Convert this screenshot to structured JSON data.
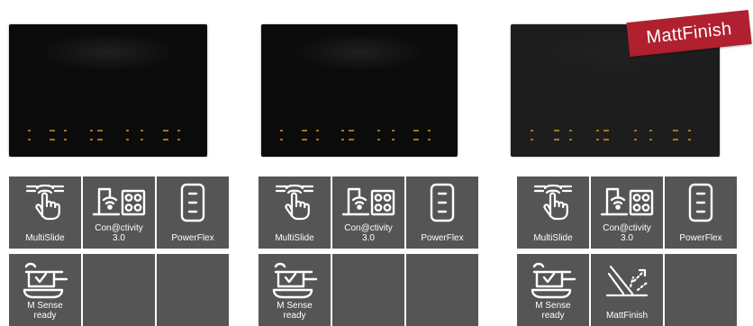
{
  "products": [
    {
      "tiles": [
        {
          "icon": "multislide-icon",
          "label": "MultiSlide"
        },
        {
          "icon": "connectivity-icon",
          "label": "Con@ctivity 3.0"
        },
        {
          "icon": "powerflex-icon",
          "label": "PowerFlex"
        },
        {
          "icon": "msense-icon",
          "label": "M Sense ready"
        },
        {
          "icon": "",
          "label": ""
        },
        {
          "icon": "",
          "label": ""
        }
      ]
    },
    {
      "tiles": [
        {
          "icon": "multislide-icon",
          "label": "MultiSlide"
        },
        {
          "icon": "connectivity-icon",
          "label": "Con@ctivity 3.0"
        },
        {
          "icon": "powerflex-icon",
          "label": "PowerFlex"
        },
        {
          "icon": "msense-icon",
          "label": "M Sense ready"
        },
        {
          "icon": "",
          "label": ""
        },
        {
          "icon": "",
          "label": ""
        }
      ]
    },
    {
      "badge": "MattFinish",
      "tiles": [
        {
          "icon": "multislide-icon",
          "label": "MultiSlide"
        },
        {
          "icon": "connectivity-icon",
          "label": "Con@ctivity 3.0"
        },
        {
          "icon": "powerflex-icon",
          "label": "PowerFlex"
        },
        {
          "icon": "msense-icon",
          "label": "M Sense ready"
        },
        {
          "icon": "mattfinish-icon",
          "label": "MattFinish"
        },
        {
          "icon": "",
          "label": ""
        }
      ]
    }
  ],
  "colors": {
    "tile": "#555555",
    "badge": "#b0202f",
    "hob": "#0b0b0b",
    "hob_matt": "#1d1d1d",
    "indicator": "#c98d1e"
  }
}
